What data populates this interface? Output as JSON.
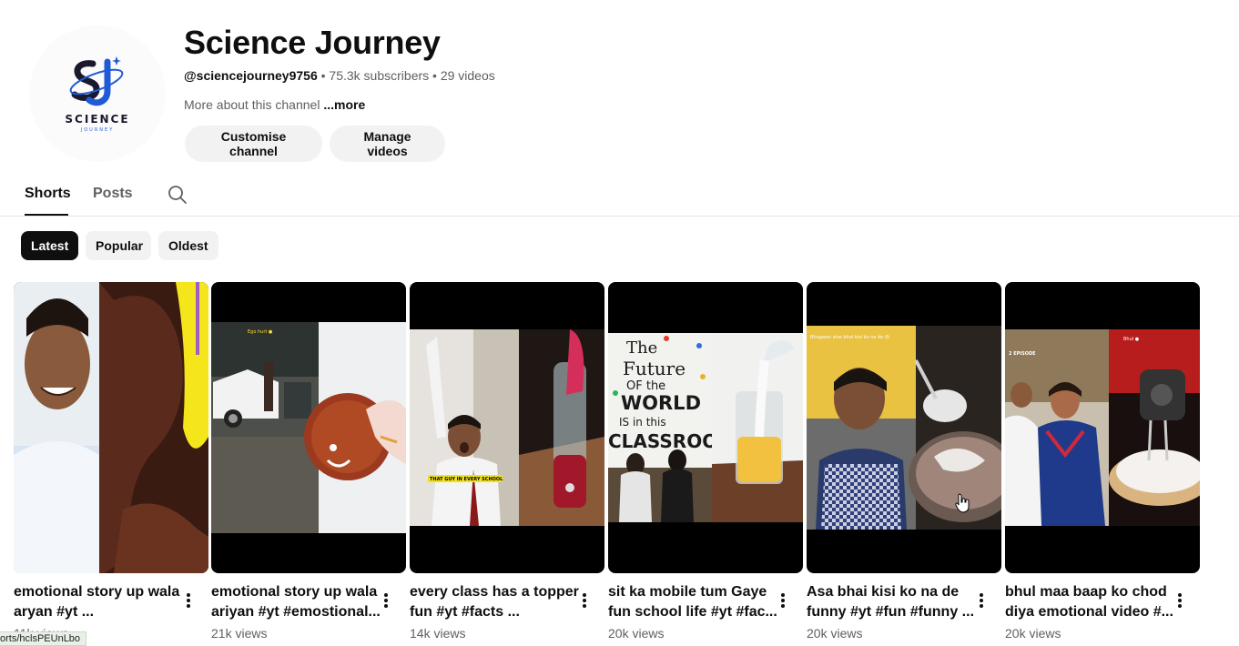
{
  "channel": {
    "name": "Science Journey",
    "handle": "@sciencejourney9756",
    "subscribers": "75.3k subscribers",
    "videos": "29 videos",
    "separator": "•",
    "about": "More about this channel",
    "more": "...more",
    "logo_word": "SCIENCE",
    "logo_sub": "JOURNEY",
    "customise_label": "Customise channel",
    "manage_label": "Manage videos"
  },
  "tabs": {
    "shorts": "Shorts",
    "posts": "Posts"
  },
  "chips": {
    "latest": "Latest",
    "popular": "Popular",
    "oldest": "Oldest"
  },
  "shorts": [
    {
      "line1": "emotional story up wala",
      "line2": "aryan #yt ...",
      "views": "11k views"
    },
    {
      "line1": "emotional story up wala",
      "line2": "ariyan #yt #emostional...",
      "views": "21k views"
    },
    {
      "line1": "every class has a topper",
      "line2": "fun #yt #facts ...",
      "views": "14k views"
    },
    {
      "line1": "sit ka mobile tum Gaye",
      "line2": "fun school life #yt #fac...",
      "views": "20k views"
    },
    {
      "line1": "Asa bhai kisi ko na de",
      "line2": "funny #yt #fun #funny ...",
      "views": "20k views"
    },
    {
      "line1": "bhul maa baap ko chod",
      "line2": "diya emotional video #...",
      "views": "20k views"
    }
  ],
  "thumb_captions": {
    "t2": "Ego hurt ●",
    "t3": "THAT GUY IN EVERY SCHOOL",
    "t4_line1": "The",
    "t4_line2": "Future",
    "t4_line3": "OF the",
    "t4_line4": "WORLD",
    "t4_line5": "IS in this",
    "t4_line6": "CLASSROOM",
    "t5": "Bhagwan aise bhai kisi ko na de 😢",
    "t6a": "2 EPISODE",
    "t6b": "Bhul ●"
  },
  "status_url": "orts/hclsPEUnLbo",
  "colors": {
    "accent": "#0f0f0f",
    "chip_bg": "#f2f2f2",
    "muted": "#606060",
    "logo_blue": "#1f5bd6"
  }
}
